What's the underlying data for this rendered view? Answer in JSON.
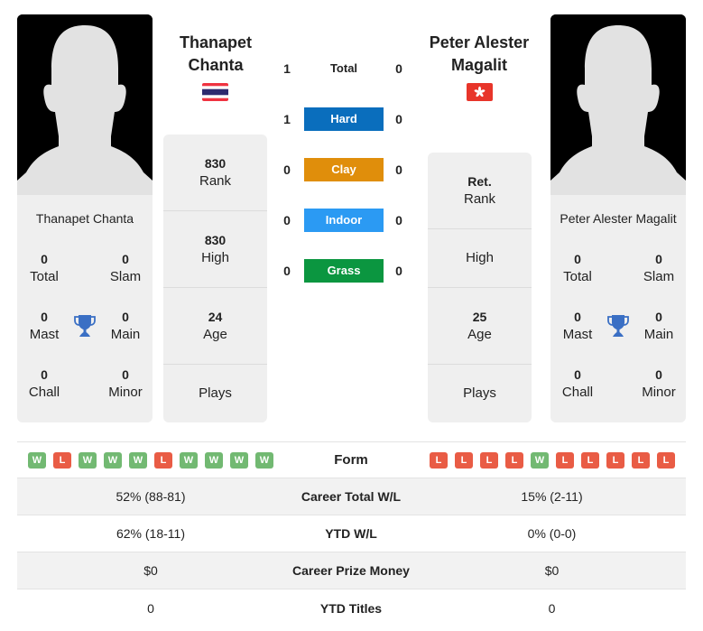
{
  "players": {
    "left": {
      "name": "Thanapet Chanta",
      "name_line1": "Thanapet",
      "name_line2": "Chanta",
      "flag": "thailand-flag",
      "titles": {
        "total": {
          "value": "0",
          "label": "Total"
        },
        "slam": {
          "value": "0",
          "label": "Slam"
        },
        "mast": {
          "value": "0",
          "label": "Mast"
        },
        "main": {
          "value": "0",
          "label": "Main"
        },
        "chall": {
          "value": "0",
          "label": "Chall"
        },
        "minor": {
          "value": "0",
          "label": "Minor"
        }
      },
      "stats": [
        {
          "value": "830",
          "label": "Rank"
        },
        {
          "value": "830",
          "label": "High"
        },
        {
          "value": "24",
          "label": "Age"
        },
        {
          "value": "",
          "label": "Plays"
        }
      ],
      "form": [
        "W",
        "L",
        "W",
        "W",
        "W",
        "L",
        "W",
        "W",
        "W",
        "W"
      ]
    },
    "right": {
      "name": "Peter Alester Magalit",
      "name_line1": "Peter Alester",
      "name_line2": "Magalit",
      "flag": "hong-kong-flag",
      "titles": {
        "total": {
          "value": "0",
          "label": "Total"
        },
        "slam": {
          "value": "0",
          "label": "Slam"
        },
        "mast": {
          "value": "0",
          "label": "Mast"
        },
        "main": {
          "value": "0",
          "label": "Main"
        },
        "chall": {
          "value": "0",
          "label": "Chall"
        },
        "minor": {
          "value": "0",
          "label": "Minor"
        }
      },
      "stats": [
        {
          "value": "Ret.",
          "label": "Rank"
        },
        {
          "value": "",
          "label": "High"
        },
        {
          "value": "25",
          "label": "Age"
        },
        {
          "value": "",
          "label": "Plays"
        }
      ],
      "form": [
        "L",
        "L",
        "L",
        "L",
        "W",
        "L",
        "L",
        "L",
        "L",
        "L"
      ]
    }
  },
  "h2h": [
    {
      "surface": "Total",
      "left": "1",
      "right": "0",
      "color": ""
    },
    {
      "surface": "Hard",
      "left": "1",
      "right": "0",
      "color": "#0a6ebd"
    },
    {
      "surface": "Clay",
      "left": "0",
      "right": "0",
      "color": "#e08e0b"
    },
    {
      "surface": "Indoor",
      "left": "0",
      "right": "0",
      "color": "#2b9af3"
    },
    {
      "surface": "Grass",
      "left": "0",
      "right": "0",
      "color": "#0b9640"
    }
  ],
  "form_label": "Form",
  "comparison": [
    {
      "label": "Career Total W/L",
      "left": "52% (88-81)",
      "right": "15% (2-11)"
    },
    {
      "label": "YTD W/L",
      "left": "62% (18-11)",
      "right": "0% (0-0)"
    },
    {
      "label": "Career Prize Money",
      "left": "$0",
      "right": "$0"
    },
    {
      "label": "YTD Titles",
      "left": "0",
      "right": "0"
    }
  ],
  "colors": {
    "win": "#72b972",
    "loss": "#e95c45",
    "trophy": "#3a6fc4"
  }
}
